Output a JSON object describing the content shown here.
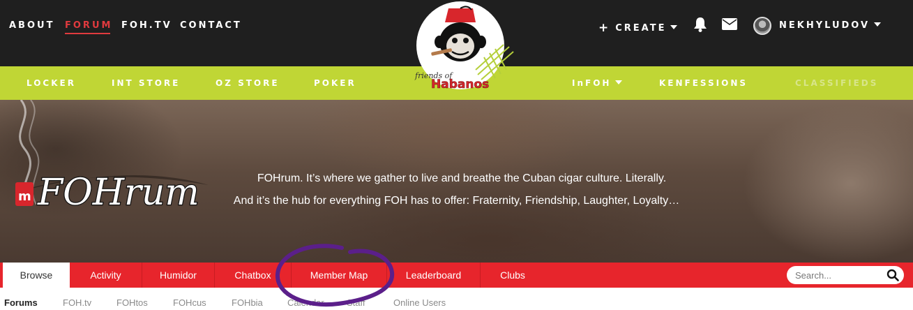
{
  "top_nav": {
    "items": [
      "ABOUT",
      "FORUM",
      "FOH.TV",
      "CONTACT"
    ],
    "active": "FORUM"
  },
  "user_nav": {
    "create_label": "CREATE",
    "username": "NEKHYLUDOV",
    "icons": [
      "bell-icon",
      "mail-icon",
      "avatar"
    ]
  },
  "logo": {
    "text_small": "friends of",
    "text_brand": "Habanos"
  },
  "green_nav": {
    "items": [
      "LOCKER",
      "INT STORE",
      "OZ STORE",
      "POKER",
      "InFOH",
      "KENFESSIONS",
      "CLASSIFIEDS"
    ]
  },
  "hero": {
    "brand": "FOHrum",
    "line1": "FOHrum. It’s where we gather to live and breathe the Cuban cigar culture. Literally.",
    "line2": "And it’s the hub for everything FOH has to offer: Fraternity, Friendship, Laughter, Loyalty…"
  },
  "tabs": {
    "items": [
      "Browse",
      "Activity",
      "Humidor",
      "Chatbox",
      "Member Map",
      "Leaderboard",
      "Clubs"
    ],
    "active": "Browse"
  },
  "search": {
    "placeholder": "Search..."
  },
  "sub_nav": {
    "items": [
      "Forums",
      "FOH.tv",
      "FOHtos",
      "FOHcus",
      "FOHbia",
      "Calendar",
      "Staff",
      "Online Users"
    ],
    "active": "Forums"
  },
  "colors": {
    "top_bar": "#1f1f1f",
    "green_bar": "#c0d635",
    "red_bar": "#e7252c",
    "accent_red": "#e03a3e",
    "annotation": "#5b1f8a"
  }
}
